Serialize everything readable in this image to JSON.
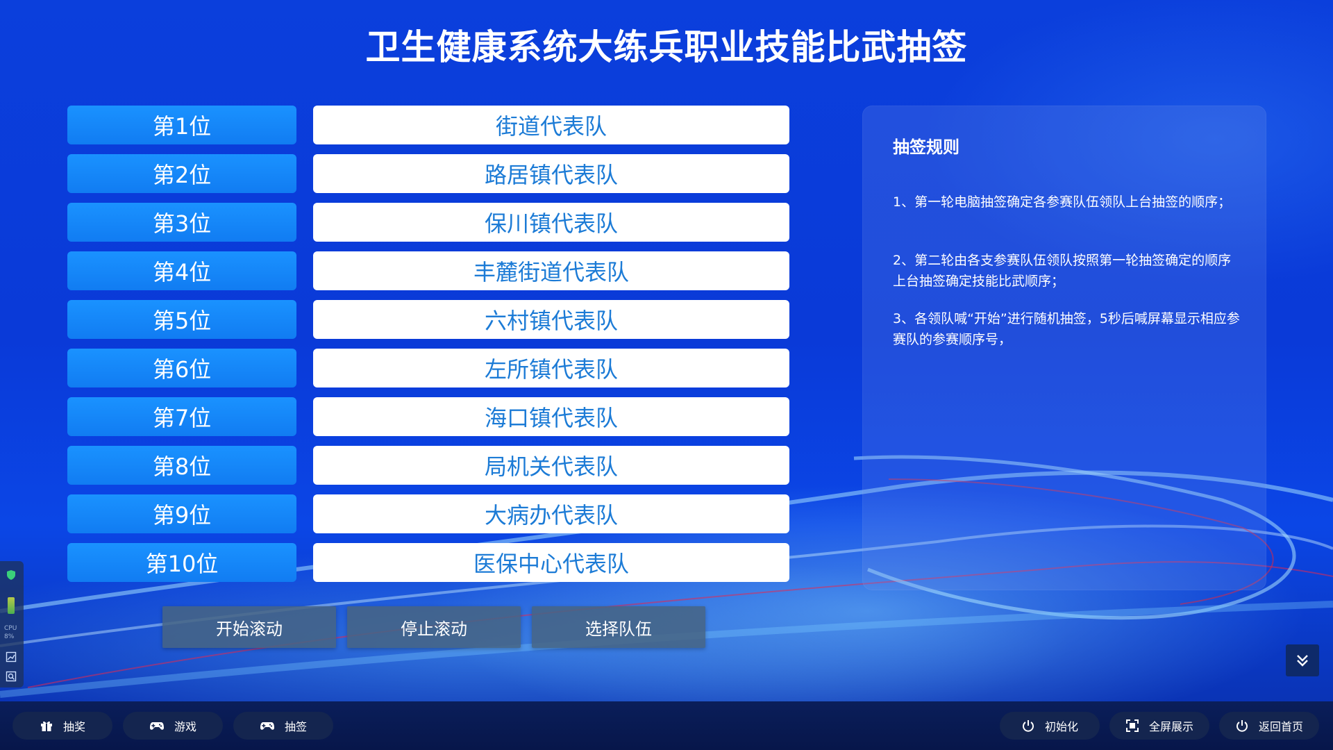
{
  "header": {
    "title": "卫生健康系统大练兵职业技能比武抽签"
  },
  "draw_list": [
    {
      "rank": "第1位",
      "team": "街道代表队"
    },
    {
      "rank": "第2位",
      "team": "路居镇代表队"
    },
    {
      "rank": "第3位",
      "team": "保川镇代表队"
    },
    {
      "rank": "第4位",
      "team": "丰麓街道代表队"
    },
    {
      "rank": "第5位",
      "team": "六村镇代表队"
    },
    {
      "rank": "第6位",
      "team": "左所镇代表队"
    },
    {
      "rank": "第7位",
      "team": "海口镇代表队"
    },
    {
      "rank": "第8位",
      "team": "局机关代表队"
    },
    {
      "rank": "第9位",
      "team": "大病办代表队"
    },
    {
      "rank": "第10位",
      "team": "医保中心代表队"
    }
  ],
  "rules": {
    "title": "抽签规则",
    "items": [
      "1、第一轮电脑抽签确定各参赛队伍领队上台抽签的顺序；",
      "2、第二轮由各支参赛队伍领队按照第一轮抽签确定的顺序上台抽签确定技能比武顺序；",
      "3、各领队喊“开始”进行随机抽签，5秒后喊屏幕显示相应参赛队的参赛顺序号，"
    ]
  },
  "controls": {
    "start_scroll": "开始滚动",
    "stop_scroll": "停止滚动",
    "select_team": "选择队伍"
  },
  "bottom_nav": {
    "left": [
      {
        "label": "抽奖",
        "icon": "gift-icon"
      },
      {
        "label": "游戏",
        "icon": "gamepad-icon"
      },
      {
        "label": "抽签",
        "icon": "gamepad-icon"
      }
    ],
    "right": [
      {
        "label": "初始化",
        "icon": "power-icon"
      },
      {
        "label": "全屏展示",
        "icon": "fullscreen-icon"
      },
      {
        "label": "返回首页",
        "icon": "power-icon"
      }
    ]
  },
  "monitor": {
    "cpu_label": "CPU",
    "cpu_value": "8%"
  },
  "colors": {
    "accent_blue": "#117cf2",
    "team_text": "#1c7bd6",
    "background": "#0a3ad8"
  }
}
